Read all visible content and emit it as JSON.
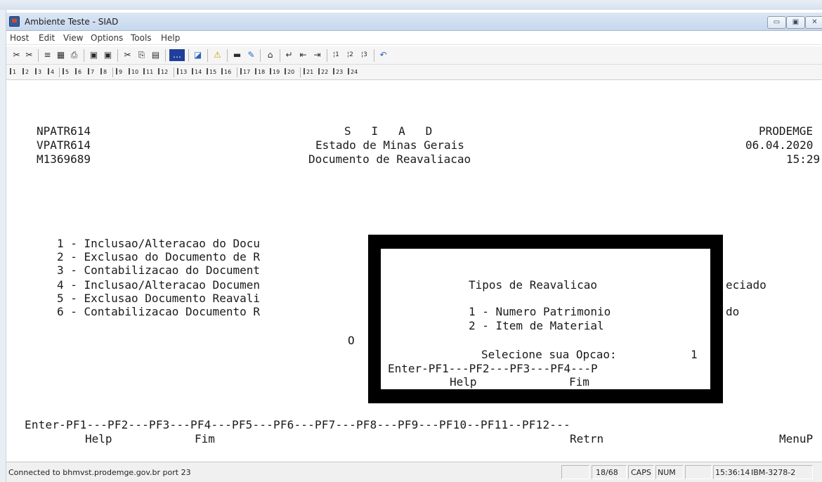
{
  "window": {
    "title": "Ambiente Teste - SIAD",
    "minimize_glyph": "▭",
    "maximize_glyph": "▣",
    "close_glyph": "✕"
  },
  "menu": [
    "Host",
    "Edit",
    "View",
    "Options",
    "Tools",
    "Help"
  ],
  "toolbar_icons": [
    {
      "name": "connect-icon",
      "glyph": "✂"
    },
    {
      "name": "disconnect-icon",
      "glyph": "✂"
    },
    {
      "name": "send-file-icon",
      "glyph": "≡"
    },
    {
      "name": "receive-file-icon",
      "glyph": "▦"
    },
    {
      "name": "print-icon",
      "glyph": "⎙"
    },
    {
      "name": "page-setup-icon",
      "glyph": "▣"
    },
    {
      "name": "print-screen-icon",
      "glyph": "▣"
    },
    {
      "name": "cut-icon",
      "glyph": "✂"
    },
    {
      "name": "copy-icon",
      "glyph": "⎘"
    },
    {
      "name": "paste-icon",
      "glyph": "▤"
    },
    {
      "name": "macro-icon",
      "glyph": "…"
    },
    {
      "name": "graph-icon",
      "glyph": "◪"
    },
    {
      "name": "alert-icon",
      "glyph": "⚠"
    },
    {
      "name": "screen-icon",
      "glyph": "▬"
    },
    {
      "name": "pen-icon",
      "glyph": "✎"
    },
    {
      "name": "home-icon",
      "glyph": "⌂"
    },
    {
      "name": "enter-icon",
      "glyph": "↵"
    },
    {
      "name": "backtab-icon",
      "glyph": "⇤"
    },
    {
      "name": "tab-icon",
      "glyph": "⇥"
    },
    {
      "name": "pa1-icon",
      "glyph": "¦1"
    },
    {
      "name": "pa2-icon",
      "glyph": "¦2"
    },
    {
      "name": "pa3-icon",
      "glyph": "¦3"
    },
    {
      "name": "undo-icon",
      "glyph": "↶"
    }
  ],
  "pf_keys": [
    "1",
    "2",
    "3",
    "4",
    "5",
    "6",
    "7",
    "8",
    "9",
    "10",
    "11",
    "12",
    "13",
    "14",
    "15",
    "16",
    "17",
    "18",
    "19",
    "20",
    "21",
    "22",
    "23",
    "24"
  ],
  "terminal": {
    "header_left": [
      "NPATR614",
      "VPATR614",
      "M1369689"
    ],
    "header_center": [
      "S   I   A   D",
      "Estado de Minas Gerais",
      "Documento de Reavaliacao"
    ],
    "header_right": [
      "PRODEMGE",
      "06.04.2020",
      "15:29"
    ],
    "menu_options": [
      "1 - Inclusao/Alteracao do Docu",
      "2 - Exclusao do Documento de R",
      "3 - Contabilizacao do Document",
      "4 - Inclusao/Alteracao Documen",
      "5 - Exclusao Documento Reavali",
      "6 - Contabilizacao Documento R"
    ],
    "option_prompt": "O",
    "right_fragments": [
      "eciado",
      "do"
    ],
    "pf_line": "Enter-PF1---PF2---PF3---PF4---PF5---PF6---PF7---PF8---PF9---PF10--PF11--PF12---",
    "pf_labels": [
      {
        "key": "PF1",
        "label": "Help"
      },
      {
        "key": "PF3",
        "label": "Fim"
      },
      {
        "key": "PF9",
        "label": "Retrn"
      },
      {
        "key": "PF12",
        "label": "MenuP"
      }
    ]
  },
  "popup": {
    "title": "Tipos de Reavalicao",
    "options": [
      "1 - Numero Patrimonio",
      "2 - Item de Material"
    ],
    "prompt_label": "Selecione sua Opcao:",
    "prompt_value": "1",
    "pf_line": "Enter-PF1---PF2---PF3---PF4---P",
    "pf_help": "Help",
    "pf_fim": "Fim"
  },
  "status": {
    "connection": "Connected to bhmvst.prodemge.gov.br port 23",
    "cursor_pos": "18/68",
    "caps": "CAPS",
    "num": "NUM",
    "time": "15:36:14",
    "terminal_type": "IBM-3278-2"
  }
}
